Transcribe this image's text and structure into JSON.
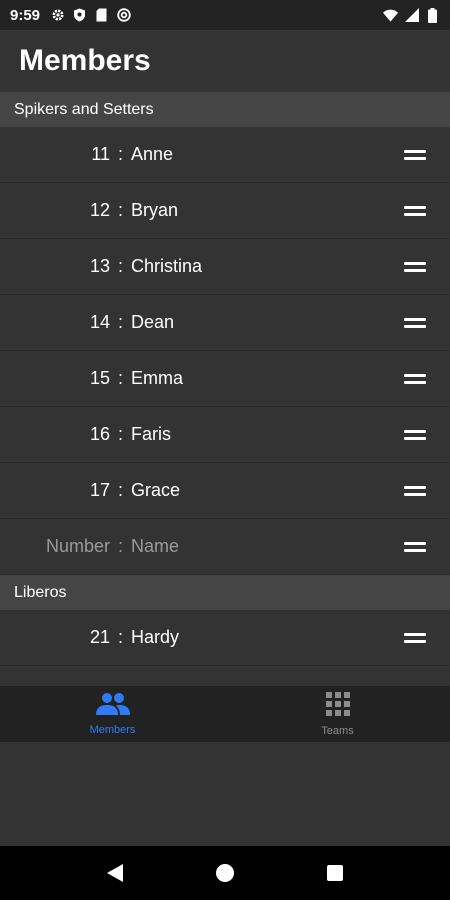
{
  "status_bar": {
    "time": "9:59",
    "left_icons": [
      "gear-icon",
      "shield-icon",
      "sim-card-icon",
      "at-sign-icon"
    ],
    "right_icons": [
      "wifi-icon",
      "signal-icon",
      "battery-icon"
    ]
  },
  "header": {
    "title": "Members"
  },
  "sections": [
    {
      "title": "Spikers and Setters",
      "members": [
        {
          "number": "11",
          "separator": ":",
          "name": "Anne"
        },
        {
          "number": "12",
          "separator": ":",
          "name": "Bryan"
        },
        {
          "number": "13",
          "separator": ":",
          "name": "Christina"
        },
        {
          "number": "14",
          "separator": ":",
          "name": "Dean"
        },
        {
          "number": "15",
          "separator": ":",
          "name": "Emma"
        },
        {
          "number": "16",
          "separator": ":",
          "name": "Faris"
        },
        {
          "number": "17",
          "separator": ":",
          "name": "Grace"
        }
      ],
      "new_entry": {
        "number_placeholder": "Number",
        "separator": ":",
        "name_placeholder": "Name"
      }
    },
    {
      "title": "Liberos",
      "members": [
        {
          "number": "21",
          "separator": ":",
          "name": "Hardy"
        }
      ]
    }
  ],
  "bottom_nav": {
    "items": [
      {
        "label": "Members",
        "icon": "people-icon",
        "active": true
      },
      {
        "label": "Teams",
        "icon": "grid-icon",
        "active": false
      }
    ],
    "active_color": "#2f7cf6",
    "inactive_color": "#8c8c8c"
  },
  "system_nav": {
    "icons": [
      "back-icon",
      "home-icon",
      "recents-icon"
    ]
  },
  "colors": {
    "background": "#333333",
    "section_header": "#454545",
    "nav_bar": "#222222"
  }
}
